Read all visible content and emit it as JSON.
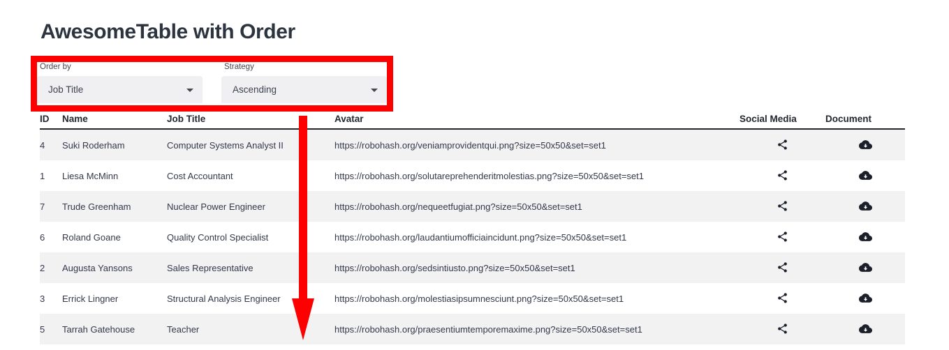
{
  "page": {
    "title": "AwesomeTable with Order"
  },
  "controls": {
    "order_by": {
      "label": "Order by",
      "value": "Job Title",
      "caret_icon": "chevron-down-icon"
    },
    "strategy": {
      "label": "Strategy",
      "value": "Ascending",
      "caret_icon": "chevron-down-icon"
    }
  },
  "annotations": {
    "highlight_color": "#fe0000",
    "box_target": "order-controls",
    "arrow_target": "job-title-column"
  },
  "table": {
    "columns": [
      {
        "key": "id",
        "label": "ID"
      },
      {
        "key": "name",
        "label": "Name"
      },
      {
        "key": "job_title",
        "label": "Job Title"
      },
      {
        "key": "avatar",
        "label": "Avatar"
      },
      {
        "key": "social_media",
        "label": "Social Media"
      },
      {
        "key": "document",
        "label": "Document"
      }
    ],
    "icons": {
      "social_media": "share-icon",
      "document": "cloud-download-icon"
    },
    "rows": [
      {
        "id": "4",
        "name": "Suki Roderham",
        "job_title": "Computer Systems Analyst II",
        "avatar": "https://robohash.org/veniamprovidentqui.png?size=50x50&set=set1"
      },
      {
        "id": "1",
        "name": "Liesa McMinn",
        "job_title": "Cost Accountant",
        "avatar": "https://robohash.org/solutareprehenderitmolestias.png?size=50x50&set=set1"
      },
      {
        "id": "7",
        "name": "Trude Greenham",
        "job_title": "Nuclear Power Engineer",
        "avatar": "https://robohash.org/nequeetfugiat.png?size=50x50&set=set1"
      },
      {
        "id": "6",
        "name": "Roland Goane",
        "job_title": "Quality Control Specialist",
        "avatar": "https://robohash.org/laudantiumofficiaincidunt.png?size=50x50&set=set1"
      },
      {
        "id": "2",
        "name": "Augusta Yansons",
        "job_title": "Sales Representative",
        "avatar": "https://robohash.org/sedsintiusto.png?size=50x50&set=set1"
      },
      {
        "id": "3",
        "name": "Errick Lingner",
        "job_title": "Structural Analysis Engineer",
        "avatar": "https://robohash.org/molestiasipsumnesciunt.png?size=50x50&set=set1"
      },
      {
        "id": "5",
        "name": "Tarrah Gatehouse",
        "job_title": "Teacher",
        "avatar": "https://robohash.org/praesentiumtemporemaxime.png?size=50x50&set=set1"
      }
    ]
  }
}
